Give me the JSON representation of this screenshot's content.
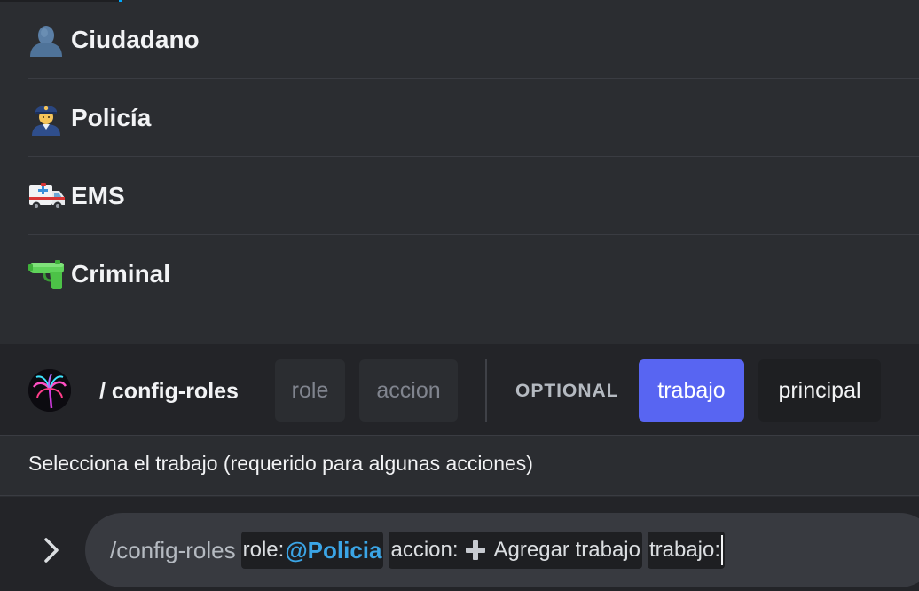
{
  "options": [
    {
      "icon": "bust-silhouette-icon",
      "label": "Ciudadano"
    },
    {
      "icon": "police-officer-icon",
      "label": "Policía"
    },
    {
      "icon": "ambulance-icon",
      "label": "EMS"
    },
    {
      "icon": "water-pistol-icon",
      "label": "Criminal"
    }
  ],
  "command_bar": {
    "avatar_icon": "palm-tree-neon-icon",
    "command": "/ config-roles",
    "required_params": [
      "role",
      "accion"
    ],
    "optional_label": "OPTIONAL",
    "optional_params": [
      {
        "label": "trabajo",
        "state": "active"
      },
      {
        "label": "principal",
        "state": "inactive"
      }
    ]
  },
  "description": "Selecciona el trabajo (requerido para algunas acciones)",
  "input": {
    "prompt_icon": "chevron-right-icon",
    "command_text": "/config-roles",
    "role_key": "role:",
    "role_value": "@Policia",
    "accion_key": "accion:",
    "accion_icon": "heavy-plus-icon",
    "accion_value": "Agregar trabajo",
    "trabajo_key": "trabajo:"
  },
  "colors": {
    "accent": "#5865f2",
    "mention": "#3ba5e6",
    "background": "#2b2d31",
    "bar_background": "#232428"
  }
}
